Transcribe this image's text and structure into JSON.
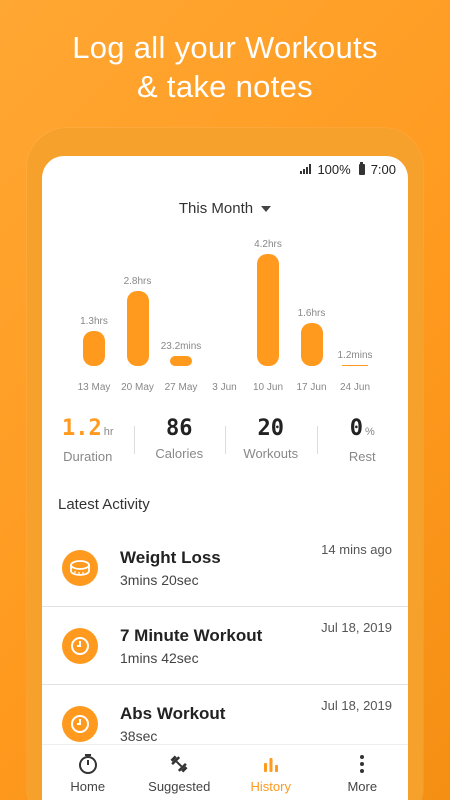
{
  "headline": {
    "line1": "Log all your Workouts",
    "line2": "& take notes"
  },
  "status_bar": {
    "battery_percent": "100%",
    "time": "7:00"
  },
  "period_selector": {
    "label": "This Month"
  },
  "chart_data": {
    "type": "bar",
    "categories": [
      "13 May",
      "20 May",
      "27 May",
      "3 Jun",
      "10 Jun",
      "17 Jun",
      "24 Jun"
    ],
    "values_hours": [
      1.3,
      2.8,
      0.387,
      0,
      4.2,
      1.6,
      0.02
    ],
    "value_labels": [
      "1.3hrs",
      "2.8hrs",
      "23.2mins",
      "",
      "4.2hrs",
      "1.6hrs",
      "1.2mins"
    ],
    "accent_color": "#ff9a1f"
  },
  "stats": {
    "duration_value": "1.2",
    "duration_unit": "hr",
    "duration_label": "Duration",
    "calories_value": "86",
    "calories_label": "Calories",
    "workouts_value": "20",
    "workouts_label": "Workouts",
    "rest_value": "0",
    "rest_unit": "%",
    "rest_label": "Rest"
  },
  "latest_activity": {
    "title": "Latest Activity",
    "items": [
      {
        "name": "Weight Loss",
        "duration": "3mins 20sec",
        "time": "14 mins ago",
        "icon": "scale-icon"
      },
      {
        "name": "7 Minute Workout",
        "duration": "1mins 42sec",
        "time": "Jul 18, 2019",
        "icon": "clock-icon"
      },
      {
        "name": "Abs Workout",
        "duration": "38sec",
        "time": "Jul 18, 2019",
        "icon": "clock-icon"
      }
    ]
  },
  "bottom_nav": {
    "home": "Home",
    "suggested": "Suggested",
    "history": "History",
    "more": "More",
    "active": "history"
  }
}
